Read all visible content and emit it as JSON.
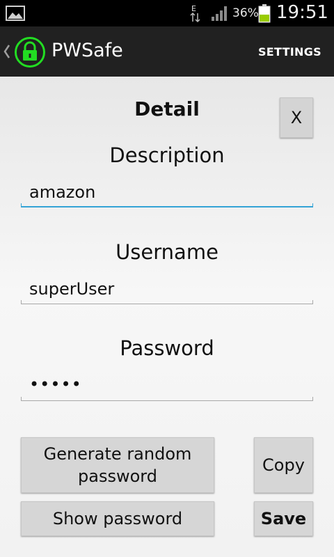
{
  "status_bar": {
    "battery_percent": "36%",
    "time": "19:51",
    "network_type": "E",
    "icons": [
      "gallery-icon",
      "data-arrows-icon",
      "signal-icon",
      "battery-icon"
    ]
  },
  "action_bar": {
    "app_title": "PWSafe",
    "settings_label": "SETTINGS",
    "icons": [
      "chevron-left-icon",
      "lock-icon"
    ]
  },
  "detail": {
    "title": "Detail",
    "close_label": "X",
    "description_label": "Description",
    "description_value": "amazon",
    "username_label": "Username",
    "username_value": "superUser",
    "password_label": "Password",
    "password_value": "•••••"
  },
  "buttons": {
    "generate_line1": "Generate random",
    "generate_line2": "password",
    "copy": "Copy",
    "show_password": "Show password",
    "save": "Save"
  },
  "colors": {
    "focus_accent": "#33a3d6",
    "lock_icon": "#22dd22",
    "battery_fill": "#99cc00"
  }
}
